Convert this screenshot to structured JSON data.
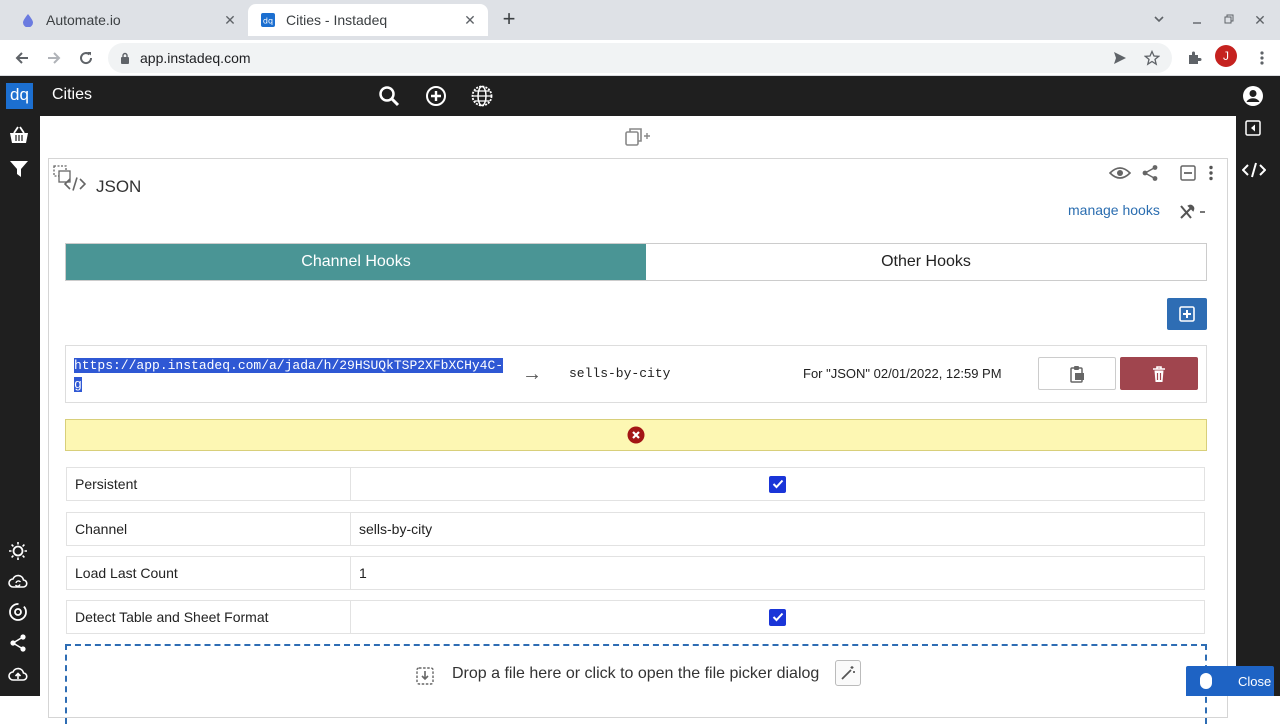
{
  "browser": {
    "tabs": [
      {
        "title": "Automate.io",
        "active": false
      },
      {
        "title": "Cities - Instadeq",
        "active": true
      }
    ],
    "url": "app.instadeq.com",
    "profile_initial": "J"
  },
  "app": {
    "logo": "dq",
    "title": "Cities"
  },
  "card": {
    "title": "JSON",
    "manage_hooks": "manage hooks",
    "tools_suffix": "-",
    "tabs": [
      {
        "label": "Channel Hooks",
        "active": true
      },
      {
        "label": "Other Hooks",
        "active": false
      }
    ],
    "hook": {
      "url": "https://app.instadeq.com/a/jada/h/29HSUQkTSP2XFbXCHy4C-g",
      "arrow": "→",
      "channel": "sells-by-city",
      "meta": "For \"JSON\" 02/01/2022, 12:59 PM"
    },
    "properties": [
      {
        "label": "Persistent",
        "type": "checkbox",
        "checked": true
      },
      {
        "label": "Channel",
        "type": "text",
        "value": "sells-by-city"
      },
      {
        "label": "Load Last Count",
        "type": "text",
        "value": "1"
      },
      {
        "label": "Detect Table and Sheet Format",
        "type": "checkbox",
        "checked": true
      }
    ],
    "dropzone_text": "Drop a file here or click to open the file picker dialog"
  },
  "close_button": "Close",
  "colors": {
    "appbar": "#1f1f1f",
    "active_tab": "#4a9595",
    "primary": "#2e6db4",
    "danger": "#a0454e",
    "warning_bg": "#fdf7b3"
  }
}
